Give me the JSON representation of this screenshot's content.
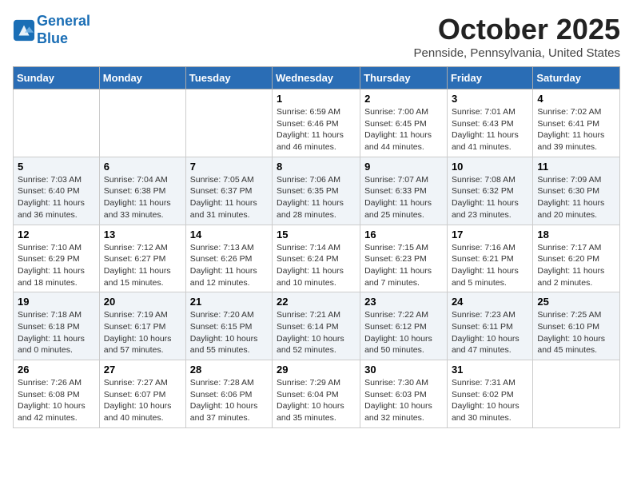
{
  "header": {
    "logo_line1": "General",
    "logo_line2": "Blue",
    "month": "October 2025",
    "location": "Pennside, Pennsylvania, United States"
  },
  "days_of_week": [
    "Sunday",
    "Monday",
    "Tuesday",
    "Wednesday",
    "Thursday",
    "Friday",
    "Saturday"
  ],
  "weeks": [
    [
      {
        "num": "",
        "info": ""
      },
      {
        "num": "",
        "info": ""
      },
      {
        "num": "",
        "info": ""
      },
      {
        "num": "1",
        "info": "Sunrise: 6:59 AM\nSunset: 6:46 PM\nDaylight: 11 hours\nand 46 minutes."
      },
      {
        "num": "2",
        "info": "Sunrise: 7:00 AM\nSunset: 6:45 PM\nDaylight: 11 hours\nand 44 minutes."
      },
      {
        "num": "3",
        "info": "Sunrise: 7:01 AM\nSunset: 6:43 PM\nDaylight: 11 hours\nand 41 minutes."
      },
      {
        "num": "4",
        "info": "Sunrise: 7:02 AM\nSunset: 6:41 PM\nDaylight: 11 hours\nand 39 minutes."
      }
    ],
    [
      {
        "num": "5",
        "info": "Sunrise: 7:03 AM\nSunset: 6:40 PM\nDaylight: 11 hours\nand 36 minutes."
      },
      {
        "num": "6",
        "info": "Sunrise: 7:04 AM\nSunset: 6:38 PM\nDaylight: 11 hours\nand 33 minutes."
      },
      {
        "num": "7",
        "info": "Sunrise: 7:05 AM\nSunset: 6:37 PM\nDaylight: 11 hours\nand 31 minutes."
      },
      {
        "num": "8",
        "info": "Sunrise: 7:06 AM\nSunset: 6:35 PM\nDaylight: 11 hours\nand 28 minutes."
      },
      {
        "num": "9",
        "info": "Sunrise: 7:07 AM\nSunset: 6:33 PM\nDaylight: 11 hours\nand 25 minutes."
      },
      {
        "num": "10",
        "info": "Sunrise: 7:08 AM\nSunset: 6:32 PM\nDaylight: 11 hours\nand 23 minutes."
      },
      {
        "num": "11",
        "info": "Sunrise: 7:09 AM\nSunset: 6:30 PM\nDaylight: 11 hours\nand 20 minutes."
      }
    ],
    [
      {
        "num": "12",
        "info": "Sunrise: 7:10 AM\nSunset: 6:29 PM\nDaylight: 11 hours\nand 18 minutes."
      },
      {
        "num": "13",
        "info": "Sunrise: 7:12 AM\nSunset: 6:27 PM\nDaylight: 11 hours\nand 15 minutes."
      },
      {
        "num": "14",
        "info": "Sunrise: 7:13 AM\nSunset: 6:26 PM\nDaylight: 11 hours\nand 12 minutes."
      },
      {
        "num": "15",
        "info": "Sunrise: 7:14 AM\nSunset: 6:24 PM\nDaylight: 11 hours\nand 10 minutes."
      },
      {
        "num": "16",
        "info": "Sunrise: 7:15 AM\nSunset: 6:23 PM\nDaylight: 11 hours\nand 7 minutes."
      },
      {
        "num": "17",
        "info": "Sunrise: 7:16 AM\nSunset: 6:21 PM\nDaylight: 11 hours\nand 5 minutes."
      },
      {
        "num": "18",
        "info": "Sunrise: 7:17 AM\nSunset: 6:20 PM\nDaylight: 11 hours\nand 2 minutes."
      }
    ],
    [
      {
        "num": "19",
        "info": "Sunrise: 7:18 AM\nSunset: 6:18 PM\nDaylight: 11 hours\nand 0 minutes."
      },
      {
        "num": "20",
        "info": "Sunrise: 7:19 AM\nSunset: 6:17 PM\nDaylight: 10 hours\nand 57 minutes."
      },
      {
        "num": "21",
        "info": "Sunrise: 7:20 AM\nSunset: 6:15 PM\nDaylight: 10 hours\nand 55 minutes."
      },
      {
        "num": "22",
        "info": "Sunrise: 7:21 AM\nSunset: 6:14 PM\nDaylight: 10 hours\nand 52 minutes."
      },
      {
        "num": "23",
        "info": "Sunrise: 7:22 AM\nSunset: 6:12 PM\nDaylight: 10 hours\nand 50 minutes."
      },
      {
        "num": "24",
        "info": "Sunrise: 7:23 AM\nSunset: 6:11 PM\nDaylight: 10 hours\nand 47 minutes."
      },
      {
        "num": "25",
        "info": "Sunrise: 7:25 AM\nSunset: 6:10 PM\nDaylight: 10 hours\nand 45 minutes."
      }
    ],
    [
      {
        "num": "26",
        "info": "Sunrise: 7:26 AM\nSunset: 6:08 PM\nDaylight: 10 hours\nand 42 minutes."
      },
      {
        "num": "27",
        "info": "Sunrise: 7:27 AM\nSunset: 6:07 PM\nDaylight: 10 hours\nand 40 minutes."
      },
      {
        "num": "28",
        "info": "Sunrise: 7:28 AM\nSunset: 6:06 PM\nDaylight: 10 hours\nand 37 minutes."
      },
      {
        "num": "29",
        "info": "Sunrise: 7:29 AM\nSunset: 6:04 PM\nDaylight: 10 hours\nand 35 minutes."
      },
      {
        "num": "30",
        "info": "Sunrise: 7:30 AM\nSunset: 6:03 PM\nDaylight: 10 hours\nand 32 minutes."
      },
      {
        "num": "31",
        "info": "Sunrise: 7:31 AM\nSunset: 6:02 PM\nDaylight: 10 hours\nand 30 minutes."
      },
      {
        "num": "",
        "info": ""
      }
    ]
  ]
}
